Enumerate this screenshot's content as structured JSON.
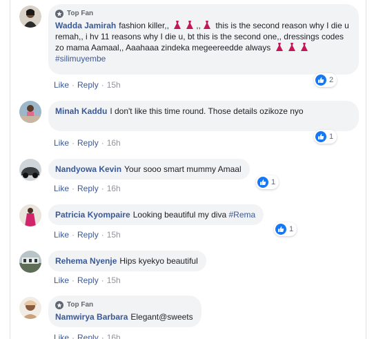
{
  "comments": [
    {
      "top_fan": "Top Fan",
      "name": "Wadda Jamirah",
      "text_parts": [
        "fashion killer,,",
        ",,",
        "this is the second reason why I die u remah,, i hv 11 reasons why I die u, bt this is the second one,, dressings codes zo mama Aamaal,, Aaahaaa zindeka megeereedde always"
      ],
      "hashtag": "#silimuyembe",
      "reactions": "2",
      "like": "Like",
      "reply": "Reply",
      "time": "15h"
    },
    {
      "name": "Minah Kaddu",
      "text": "I don't like this time round. Those details ozikoze nyo",
      "reactions": "1",
      "like": "Like",
      "reply": "Reply",
      "time": "16h"
    },
    {
      "name": "Nandyowa Kevin",
      "text": "Your sooo smart mummy Amaal",
      "reactions": "1",
      "like": "Like",
      "reply": "Reply",
      "time": "16h"
    },
    {
      "name": "Patricia Kyompaire",
      "text": "Looking beautiful my diva",
      "hashtag": "#Rema",
      "reactions": "1",
      "like": "Like",
      "reply": "Reply",
      "time": "15h"
    },
    {
      "name": "Rehema Nyenje",
      "text": "Hips kyekyo beautiful",
      "like": "Like",
      "reply": "Reply",
      "time": "15h"
    },
    {
      "top_fan": "Top Fan",
      "name": "Namwirya Barbara",
      "text": "Elegant@sweets",
      "like": "Like",
      "reply": "Reply",
      "time": "16h"
    }
  ],
  "colors": {
    "name": "#385898",
    "bubble": "#f2f3f5",
    "like_blue": "#1877f2",
    "meta": "#90949c"
  },
  "icons": [
    "top-fan-icon",
    "like-reaction-icon",
    "dress-emoji"
  ]
}
